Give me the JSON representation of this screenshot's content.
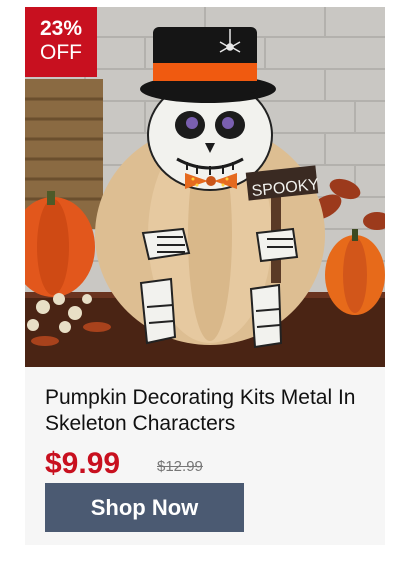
{
  "badge": {
    "percent": "23%",
    "off": "OFF"
  },
  "product": {
    "title": "Pumpkin Decorating Kits Metal In Skeleton Characters",
    "price": "$9.99",
    "original_price": "$12.99",
    "sign_text": "SPOOKY"
  },
  "cta": {
    "label": "Shop Now"
  },
  "colors": {
    "badge": "#c8101f",
    "price": "#c8101f",
    "button": "#4b5a72"
  },
  "icons": [
    "spider-icon"
  ]
}
